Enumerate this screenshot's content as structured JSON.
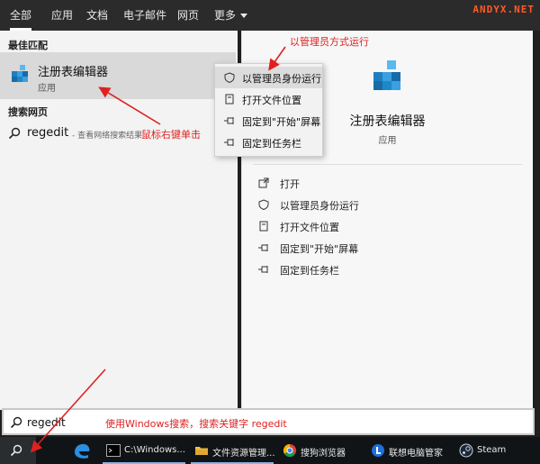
{
  "tabs": [
    {
      "label": "全部",
      "active": true
    },
    {
      "label": "应用"
    },
    {
      "label": "文档"
    },
    {
      "label": "电子邮件"
    },
    {
      "label": "网页"
    },
    {
      "label": "更多"
    }
  ],
  "watermark": "ANDYX.NET",
  "best_match": {
    "section_label": "最佳匹配",
    "title": "注册表编辑器",
    "subtitle": "应用"
  },
  "web_search": {
    "section_label": "搜索网页",
    "query": "regedit",
    "hint": "- 查看网络搜索结果"
  },
  "context_menu": {
    "items": [
      {
        "label": "以管理员身份运行",
        "icon": "admin-shield-icon"
      },
      {
        "label": "打开文件位置",
        "icon": "file-location-icon"
      },
      {
        "label": "固定到\"开始\"屏幕",
        "icon": "pin-icon"
      },
      {
        "label": "固定到任务栏",
        "icon": "pin-icon"
      }
    ]
  },
  "detail": {
    "title": "注册表编辑器",
    "subtitle": "应用",
    "actions": [
      {
        "label": "打开",
        "icon": "open-icon"
      },
      {
        "label": "以管理员身份运行",
        "icon": "admin-shield-icon"
      },
      {
        "label": "打开文件位置",
        "icon": "file-location-icon"
      },
      {
        "label": "固定到\"开始\"屏幕",
        "icon": "pin-icon"
      },
      {
        "label": "固定到任务栏",
        "icon": "pin-icon"
      }
    ]
  },
  "search": {
    "value": "regedit"
  },
  "taskbar": {
    "items": [
      {
        "label": "C:\\Windows...",
        "icon": "cmd-icon"
      },
      {
        "label": "文件资源管理...",
        "icon": "folder-icon"
      },
      {
        "label": "搜狗浏览器",
        "icon": "chrome-icon"
      },
      {
        "label": "联想电脑管家",
        "icon": "lenovo-icon"
      },
      {
        "label": "Steam",
        "icon": "steam-icon"
      }
    ]
  },
  "annotations": {
    "run_as_admin": "以管理员方式运行",
    "right_click": "鼠标右键单击",
    "search_hint": "使用Windows搜索，搜索关键字 regedit"
  },
  "colors": {
    "annotation": "#e02020",
    "accent_blue": "#1e88c8",
    "watermark": "#ff5a2b"
  }
}
